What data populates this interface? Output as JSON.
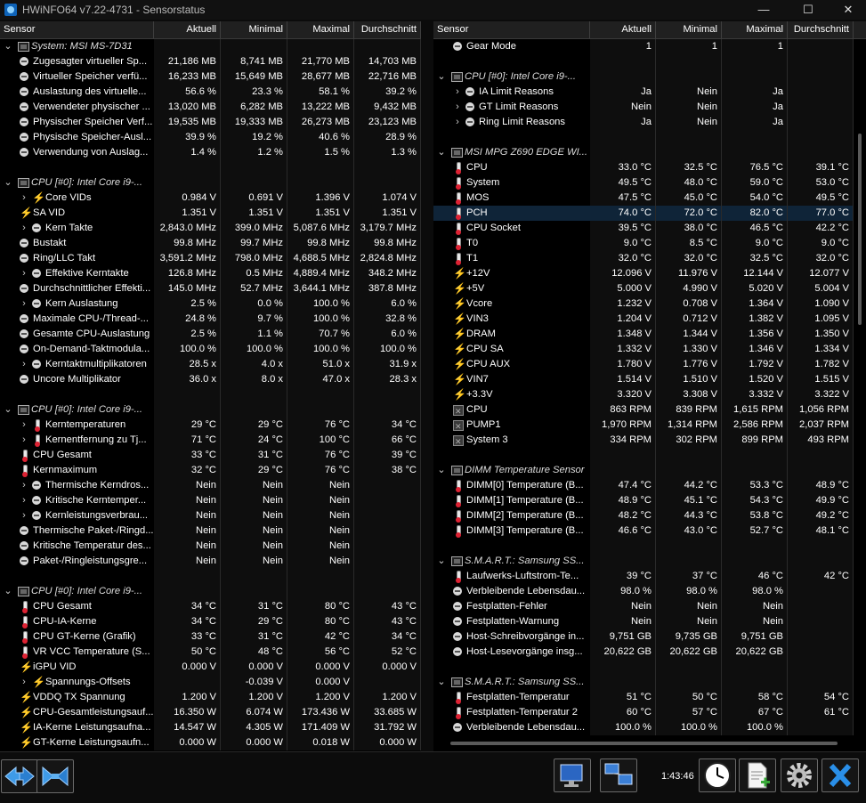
{
  "window": {
    "title": "HWiNFO64 v7.22-4731 - Sensorstatus"
  },
  "left": {
    "headers": {
      "sensor": "Sensor",
      "current": "Aktuell",
      "min": "Minimal",
      "max": "Maximal",
      "avg": "Durchschnitt"
    },
    "rows": [
      {
        "t": "group",
        "name": "System: MSI MS-7D31",
        "icon": "chip-icon"
      },
      {
        "t": "item",
        "name": "Zugesagter virtueller Sp...",
        "icon": "circle-icon",
        "exp": "",
        "cur": "21,186 MB",
        "min": "8,741 MB",
        "max": "21,770 MB",
        "avg": "14,703 MB"
      },
      {
        "t": "item",
        "name": "Virtueller Speicher verfü...",
        "icon": "circle-icon",
        "exp": "",
        "cur": "16,233 MB",
        "min": "15,649 MB",
        "max": "28,677 MB",
        "avg": "22,716 MB"
      },
      {
        "t": "item",
        "name": "Auslastung des virtuelle...",
        "icon": "circle-icon",
        "exp": "",
        "cur": "56.6 %",
        "min": "23.3 %",
        "max": "58.1 %",
        "avg": "39.2 %"
      },
      {
        "t": "item",
        "name": "Verwendeter physischer ...",
        "icon": "circle-icon",
        "exp": "",
        "cur": "13,020 MB",
        "min": "6,282 MB",
        "max": "13,222 MB",
        "avg": "9,432 MB"
      },
      {
        "t": "item",
        "name": "Physischer Speicher Verf...",
        "icon": "circle-icon",
        "exp": "",
        "cur": "19,535 MB",
        "min": "19,333 MB",
        "max": "26,273 MB",
        "avg": "23,123 MB"
      },
      {
        "t": "item",
        "name": "Physische Speicher-Ausl...",
        "icon": "circle-icon",
        "exp": "",
        "cur": "39.9 %",
        "min": "19.2 %",
        "max": "40.6 %",
        "avg": "28.9 %"
      },
      {
        "t": "item",
        "name": "Verwendung von Auslag...",
        "icon": "circle-icon",
        "exp": "",
        "cur": "1.4 %",
        "min": "1.2 %",
        "max": "1.5 %",
        "avg": "1.3 %"
      },
      {
        "t": "blank"
      },
      {
        "t": "group",
        "name": "CPU [#0]: Intel Core i9-...",
        "icon": "chip-icon"
      },
      {
        "t": "item",
        "name": "Core VIDs",
        "icon": "bolt-icon",
        "exp": ">",
        "cur": "0.984 V",
        "min": "0.691 V",
        "max": "1.396 V",
        "avg": "1.074 V"
      },
      {
        "t": "item",
        "name": "SA VID",
        "icon": "bolt-icon",
        "exp": "",
        "cur": "1.351 V",
        "min": "1.351 V",
        "max": "1.351 V",
        "avg": "1.351 V"
      },
      {
        "t": "item",
        "name": "Kern Takte",
        "icon": "circle-icon",
        "exp": ">",
        "cur": "2,843.0 MHz",
        "min": "399.0 MHz",
        "max": "5,087.6 MHz",
        "avg": "3,179.7 MHz"
      },
      {
        "t": "item",
        "name": "Bustakt",
        "icon": "circle-icon",
        "exp": "",
        "cur": "99.8 MHz",
        "min": "99.7 MHz",
        "max": "99.8 MHz",
        "avg": "99.8 MHz"
      },
      {
        "t": "item",
        "name": "Ring/LLC Takt",
        "icon": "circle-icon",
        "exp": "",
        "cur": "3,591.2 MHz",
        "min": "798.0 MHz",
        "max": "4,688.5 MHz",
        "avg": "2,824.8 MHz"
      },
      {
        "t": "item",
        "name": "Effektive Kerntakte",
        "icon": "circle-icon",
        "exp": ">",
        "cur": "126.8 MHz",
        "min": "0.5 MHz",
        "max": "4,889.4 MHz",
        "avg": "348.2 MHz"
      },
      {
        "t": "item",
        "name": "Durchschnittlicher Effekti...",
        "icon": "circle-icon",
        "exp": "",
        "cur": "145.0 MHz",
        "min": "52.7 MHz",
        "max": "3,644.1 MHz",
        "avg": "387.8 MHz"
      },
      {
        "t": "item",
        "name": "Kern Auslastung",
        "icon": "circle-icon",
        "exp": ">",
        "cur": "2.5 %",
        "min": "0.0 %",
        "max": "100.0 %",
        "avg": "6.0 %"
      },
      {
        "t": "item",
        "name": "Maximale CPU-/Thread-...",
        "icon": "circle-icon",
        "exp": "",
        "cur": "24.8 %",
        "min": "9.7 %",
        "max": "100.0 %",
        "avg": "32.8 %"
      },
      {
        "t": "item",
        "name": "Gesamte CPU-Auslastung",
        "icon": "circle-icon",
        "exp": "",
        "cur": "2.5 %",
        "min": "1.1 %",
        "max": "70.7 %",
        "avg": "6.0 %"
      },
      {
        "t": "item",
        "name": "On-Demand-Taktmodula...",
        "icon": "circle-icon",
        "exp": "",
        "cur": "100.0 %",
        "min": "100.0 %",
        "max": "100.0 %",
        "avg": "100.0 %"
      },
      {
        "t": "item",
        "name": "Kerntaktmultiplikatoren",
        "icon": "circle-icon",
        "exp": ">",
        "cur": "28.5 x",
        "min": "4.0 x",
        "max": "51.0 x",
        "avg": "31.9 x"
      },
      {
        "t": "item",
        "name": "Uncore Multiplikator",
        "icon": "circle-icon",
        "exp": "",
        "cur": "36.0 x",
        "min": "8.0 x",
        "max": "47.0 x",
        "avg": "28.3 x"
      },
      {
        "t": "blank"
      },
      {
        "t": "group",
        "name": "CPU [#0]: Intel Core i9-...",
        "icon": "chip-icon"
      },
      {
        "t": "item",
        "name": "Kerntemperaturen",
        "icon": "therm-icon",
        "exp": ">",
        "cur": "29 °C",
        "min": "29 °C",
        "max": "76 °C",
        "avg": "34 °C"
      },
      {
        "t": "item",
        "name": "Kernentfernung zu Tj...",
        "icon": "therm-icon",
        "exp": ">",
        "cur": "71 °C",
        "min": "24 °C",
        "max": "100 °C",
        "avg": "66 °C"
      },
      {
        "t": "item",
        "name": "CPU Gesamt",
        "icon": "therm-icon",
        "exp": "",
        "cur": "33 °C",
        "min": "31 °C",
        "max": "76 °C",
        "avg": "39 °C"
      },
      {
        "t": "item",
        "name": "Kernmaximum",
        "icon": "therm-icon",
        "exp": "",
        "cur": "32 °C",
        "min": "29 °C",
        "max": "76 °C",
        "avg": "38 °C"
      },
      {
        "t": "item",
        "name": "Thermische Kerndros...",
        "icon": "circle-icon",
        "exp": ">",
        "cur": "Nein",
        "min": "Nein",
        "max": "Nein",
        "avg": ""
      },
      {
        "t": "item",
        "name": "Kritische Kerntemper...",
        "icon": "circle-icon",
        "exp": ">",
        "cur": "Nein",
        "min": "Nein",
        "max": "Nein",
        "avg": ""
      },
      {
        "t": "item",
        "name": "Kernleistungsverbrau...",
        "icon": "circle-icon",
        "exp": ">",
        "cur": "Nein",
        "min": "Nein",
        "max": "Nein",
        "avg": ""
      },
      {
        "t": "item",
        "name": "Thermische Paket-/Ringd...",
        "icon": "circle-icon",
        "exp": "",
        "cur": "Nein",
        "min": "Nein",
        "max": "Nein",
        "avg": ""
      },
      {
        "t": "item",
        "name": "Kritische Temperatur des...",
        "icon": "circle-icon",
        "exp": "",
        "cur": "Nein",
        "min": "Nein",
        "max": "Nein",
        "avg": ""
      },
      {
        "t": "item",
        "name": "Paket-/Ringleistungsgre...",
        "icon": "circle-icon",
        "exp": "",
        "cur": "Nein",
        "min": "Nein",
        "max": "Nein",
        "avg": ""
      },
      {
        "t": "blank"
      },
      {
        "t": "group",
        "name": "CPU [#0]: Intel Core i9-...",
        "icon": "chip-icon"
      },
      {
        "t": "item",
        "name": "CPU Gesamt",
        "icon": "therm-icon",
        "exp": "",
        "cur": "34 °C",
        "min": "31 °C",
        "max": "80 °C",
        "avg": "43 °C"
      },
      {
        "t": "item",
        "name": "CPU-IA-Kerne",
        "icon": "therm-icon",
        "exp": "",
        "cur": "34 °C",
        "min": "29 °C",
        "max": "80 °C",
        "avg": "43 °C"
      },
      {
        "t": "item",
        "name": "CPU GT-Kerne (Grafik)",
        "icon": "therm-icon",
        "exp": "",
        "cur": "33 °C",
        "min": "31 °C",
        "max": "42 °C",
        "avg": "34 °C"
      },
      {
        "t": "item",
        "name": "VR VCC Temperature (S...",
        "icon": "therm-icon",
        "exp": "",
        "cur": "50 °C",
        "min": "48 °C",
        "max": "56 °C",
        "avg": "52 °C"
      },
      {
        "t": "item",
        "name": "iGPU VID",
        "icon": "bolt-icon",
        "exp": "",
        "cur": "0.000 V",
        "min": "0.000 V",
        "max": "0.000 V",
        "avg": "0.000 V"
      },
      {
        "t": "item",
        "name": "Spannungs-Offsets",
        "icon": "bolt-icon",
        "exp": ">",
        "cur": "",
        "min": "-0.039 V",
        "max": "0.000 V",
        "avg": ""
      },
      {
        "t": "item",
        "name": "VDDQ TX Spannung",
        "icon": "bolt-icon",
        "exp": "",
        "cur": "1.200 V",
        "min": "1.200 V",
        "max": "1.200 V",
        "avg": "1.200 V"
      },
      {
        "t": "item",
        "name": "CPU-Gesamtleistungsauf...",
        "icon": "bolt-icon",
        "exp": "",
        "cur": "16.350 W",
        "min": "6.074 W",
        "max": "173.436 W",
        "avg": "33.685 W"
      },
      {
        "t": "item",
        "name": "IA-Kerne Leistungsaufna...",
        "icon": "bolt-icon",
        "exp": "",
        "cur": "14.547 W",
        "min": "4.305 W",
        "max": "171.409 W",
        "avg": "31.792 W"
      },
      {
        "t": "item",
        "name": "GT-Kerne Leistungsaufn...",
        "icon": "bolt-icon",
        "exp": "",
        "cur": "0.000 W",
        "min": "0.000 W",
        "max": "0.018 W",
        "avg": "0.000 W"
      }
    ]
  },
  "right": {
    "headers": {
      "sensor": "Sensor",
      "current": "Aktuell",
      "min": "Minimal",
      "max": "Maximal",
      "avg": "Durchschnitt"
    },
    "rows": [
      {
        "t": "item",
        "name": "Gear Mode",
        "icon": "circle-icon",
        "exp": "",
        "cur": "1",
        "min": "1",
        "max": "1",
        "avg": ""
      },
      {
        "t": "blank"
      },
      {
        "t": "group",
        "name": "CPU [#0]: Intel Core i9-...",
        "icon": "chip-icon"
      },
      {
        "t": "item",
        "name": "IA Limit Reasons",
        "icon": "circle-icon",
        "exp": ">",
        "cur": "Ja",
        "min": "Nein",
        "max": "Ja",
        "avg": ""
      },
      {
        "t": "item",
        "name": "GT Limit Reasons",
        "icon": "circle-icon",
        "exp": ">",
        "cur": "Nein",
        "min": "Nein",
        "max": "Ja",
        "avg": ""
      },
      {
        "t": "item",
        "name": "Ring Limit Reasons",
        "icon": "circle-icon",
        "exp": ">",
        "cur": "Ja",
        "min": "Nein",
        "max": "Ja",
        "avg": ""
      },
      {
        "t": "blank"
      },
      {
        "t": "group",
        "name": "MSI MPG Z690 EDGE WI...",
        "icon": "chip-icon"
      },
      {
        "t": "item",
        "name": "CPU",
        "icon": "therm-icon",
        "exp": "",
        "cur": "33.0 °C",
        "min": "32.5 °C",
        "max": "76.5 °C",
        "avg": "39.1 °C"
      },
      {
        "t": "item",
        "name": "System",
        "icon": "therm-icon",
        "exp": "",
        "cur": "49.5 °C",
        "min": "48.0 °C",
        "max": "59.0 °C",
        "avg": "53.0 °C"
      },
      {
        "t": "item",
        "name": "MOS",
        "icon": "therm-icon",
        "exp": "",
        "cur": "47.5 °C",
        "min": "45.0 °C",
        "max": "54.0 °C",
        "avg": "49.5 °C"
      },
      {
        "t": "item",
        "name": "PCH",
        "icon": "therm-icon",
        "exp": "",
        "cur": "74.0 °C",
        "min": "72.0 °C",
        "max": "82.0 °C",
        "avg": "77.0 °C",
        "hl": true
      },
      {
        "t": "item",
        "name": "CPU Socket",
        "icon": "therm-icon",
        "exp": "",
        "cur": "39.5 °C",
        "min": "38.0 °C",
        "max": "46.5 °C",
        "avg": "42.2 °C"
      },
      {
        "t": "item",
        "name": "T0",
        "icon": "therm-icon",
        "exp": "",
        "cur": "9.0 °C",
        "min": "8.5 °C",
        "max": "9.0 °C",
        "avg": "9.0 °C"
      },
      {
        "t": "item",
        "name": "T1",
        "icon": "therm-icon",
        "exp": "",
        "cur": "32.0 °C",
        "min": "32.0 °C",
        "max": "32.5 °C",
        "avg": "32.0 °C"
      },
      {
        "t": "item",
        "name": "+12V",
        "icon": "bolt-icon",
        "exp": "",
        "cur": "12.096 V",
        "min": "11.976 V",
        "max": "12.144 V",
        "avg": "12.077 V"
      },
      {
        "t": "item",
        "name": "+5V",
        "icon": "bolt-icon",
        "exp": "",
        "cur": "5.000 V",
        "min": "4.990 V",
        "max": "5.020 V",
        "avg": "5.004 V"
      },
      {
        "t": "item",
        "name": "Vcore",
        "icon": "bolt-icon",
        "exp": "",
        "cur": "1.232 V",
        "min": "0.708 V",
        "max": "1.364 V",
        "avg": "1.090 V"
      },
      {
        "t": "item",
        "name": "VIN3",
        "icon": "bolt-icon",
        "exp": "",
        "cur": "1.204 V",
        "min": "0.712 V",
        "max": "1.382 V",
        "avg": "1.095 V"
      },
      {
        "t": "item",
        "name": "DRAM",
        "icon": "bolt-icon",
        "exp": "",
        "cur": "1.348 V",
        "min": "1.344 V",
        "max": "1.356 V",
        "avg": "1.350 V"
      },
      {
        "t": "item",
        "name": "CPU SA",
        "icon": "bolt-icon",
        "exp": "",
        "cur": "1.332 V",
        "min": "1.330 V",
        "max": "1.346 V",
        "avg": "1.334 V"
      },
      {
        "t": "item",
        "name": "CPU AUX",
        "icon": "bolt-icon",
        "exp": "",
        "cur": "1.780 V",
        "min": "1.776 V",
        "max": "1.792 V",
        "avg": "1.782 V"
      },
      {
        "t": "item",
        "name": "VIN7",
        "icon": "bolt-icon",
        "exp": "",
        "cur": "1.514 V",
        "min": "1.510 V",
        "max": "1.520 V",
        "avg": "1.515 V"
      },
      {
        "t": "item",
        "name": "+3.3V",
        "icon": "bolt-icon",
        "exp": "",
        "cur": "3.320 V",
        "min": "3.308 V",
        "max": "3.332 V",
        "avg": "3.322 V"
      },
      {
        "t": "item",
        "name": "CPU",
        "icon": "fan-icon",
        "exp": "",
        "cur": "863 RPM",
        "min": "839 RPM",
        "max": "1,615 RPM",
        "avg": "1,056 RPM"
      },
      {
        "t": "item",
        "name": "PUMP1",
        "icon": "fan-icon",
        "exp": "",
        "cur": "1,970 RPM",
        "min": "1,314 RPM",
        "max": "2,586 RPM",
        "avg": "2,037 RPM"
      },
      {
        "t": "item",
        "name": "System 3",
        "icon": "fan-icon",
        "exp": "",
        "cur": "334 RPM",
        "min": "302 RPM",
        "max": "899 RPM",
        "avg": "493 RPM"
      },
      {
        "t": "blank"
      },
      {
        "t": "group",
        "name": "DIMM Temperature Sensor",
        "icon": "chip-icon"
      },
      {
        "t": "item",
        "name": "DIMM[0] Temperature (B...",
        "icon": "therm-icon",
        "exp": "",
        "cur": "47.4 °C",
        "min": "44.2 °C",
        "max": "53.3 °C",
        "avg": "48.9 °C"
      },
      {
        "t": "item",
        "name": "DIMM[1] Temperature (B...",
        "icon": "therm-icon",
        "exp": "",
        "cur": "48.9 °C",
        "min": "45.1 °C",
        "max": "54.3 °C",
        "avg": "49.9 °C"
      },
      {
        "t": "item",
        "name": "DIMM[2] Temperature (B...",
        "icon": "therm-icon",
        "exp": "",
        "cur": "48.2 °C",
        "min": "44.3 °C",
        "max": "53.8 °C",
        "avg": "49.2 °C"
      },
      {
        "t": "item",
        "name": "DIMM[3] Temperature (B...",
        "icon": "therm-icon",
        "exp": "",
        "cur": "46.6 °C",
        "min": "43.0 °C",
        "max": "52.7 °C",
        "avg": "48.1 °C"
      },
      {
        "t": "blank"
      },
      {
        "t": "group",
        "name": "S.M.A.R.T.: Samsung SS...",
        "icon": "chip-icon"
      },
      {
        "t": "item",
        "name": "Laufwerks-Luftstrom-Te...",
        "icon": "therm-icon",
        "exp": "",
        "cur": "39 °C",
        "min": "37 °C",
        "max": "46 °C",
        "avg": "42 °C"
      },
      {
        "t": "item",
        "name": "Verbleibende Lebensdau...",
        "icon": "circle-icon",
        "exp": "",
        "cur": "98.0 %",
        "min": "98.0 %",
        "max": "98.0 %",
        "avg": ""
      },
      {
        "t": "item",
        "name": "Festplatten-Fehler",
        "icon": "circle-icon",
        "exp": "",
        "cur": "Nein",
        "min": "Nein",
        "max": "Nein",
        "avg": ""
      },
      {
        "t": "item",
        "name": "Festplatten-Warnung",
        "icon": "circle-icon",
        "exp": "",
        "cur": "Nein",
        "min": "Nein",
        "max": "Nein",
        "avg": ""
      },
      {
        "t": "item",
        "name": "Host-Schreibvorgänge in...",
        "icon": "circle-icon",
        "exp": "",
        "cur": "9,751 GB",
        "min": "9,735 GB",
        "max": "9,751 GB",
        "avg": ""
      },
      {
        "t": "item",
        "name": "Host-Lesevorgänge insg...",
        "icon": "circle-icon",
        "exp": "",
        "cur": "20,622 GB",
        "min": "20,622 GB",
        "max": "20,622 GB",
        "avg": ""
      },
      {
        "t": "blank"
      },
      {
        "t": "group",
        "name": "S.M.A.R.T.: Samsung SS...",
        "icon": "chip-icon"
      },
      {
        "t": "item",
        "name": "Festplatten-Temperatur",
        "icon": "therm-icon",
        "exp": "",
        "cur": "51 °C",
        "min": "50 °C",
        "max": "58 °C",
        "avg": "54 °C"
      },
      {
        "t": "item",
        "name": "Festplatten-Temperatur 2",
        "icon": "therm-icon",
        "exp": "",
        "cur": "60 °C",
        "min": "57 °C",
        "max": "67 °C",
        "avg": "61 °C"
      },
      {
        "t": "item",
        "name": "Verbleibende Lebensdau...",
        "icon": "circle-icon",
        "exp": "",
        "cur": "100.0 %",
        "min": "100.0 %",
        "max": "100.0 %",
        "avg": ""
      }
    ]
  },
  "footer": {
    "timer": "1:43:46"
  },
  "colors": {
    "background": "#000000",
    "highlight": "#0f2438",
    "group_text": "#dcdcdc",
    "bolt": "#f2c40f",
    "close_x": "#2a8fe8"
  }
}
